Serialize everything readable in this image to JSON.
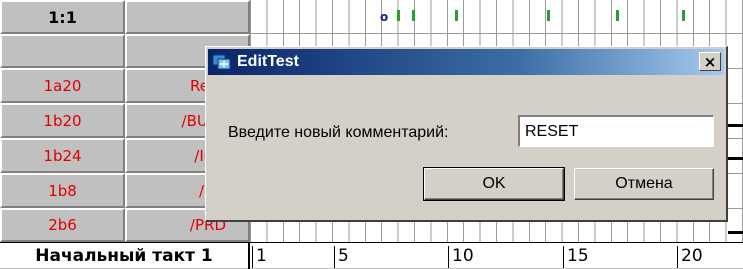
{
  "table": {
    "header_left": "1:1",
    "header_right": "",
    "rows": [
      {
        "address": "1a20",
        "signal": "Rese"
      },
      {
        "address": "1b20",
        "signal": "/BUSF"
      },
      {
        "address": "1b24",
        "signal": "/IOR"
      },
      {
        "address": "1b8",
        "signal": "/RD"
      },
      {
        "address": "2b6",
        "signal": "/PRD"
      }
    ],
    "footer_label": "Начальный такт 1",
    "ruler": [
      "1",
      "5",
      "10",
      "15",
      "20"
    ],
    "marker_top": "o"
  },
  "dialog": {
    "title": "EditTest",
    "close_glyph": "×",
    "prompt": "Введите новый комментарий:",
    "input_value": "RESET",
    "ok_label": "OK",
    "cancel_label": "Отмена",
    "icon": "app-icon",
    "colors": {
      "title_start": "#0a246a",
      "title_end": "#a6caf0",
      "label_red": "#e00000"
    }
  }
}
